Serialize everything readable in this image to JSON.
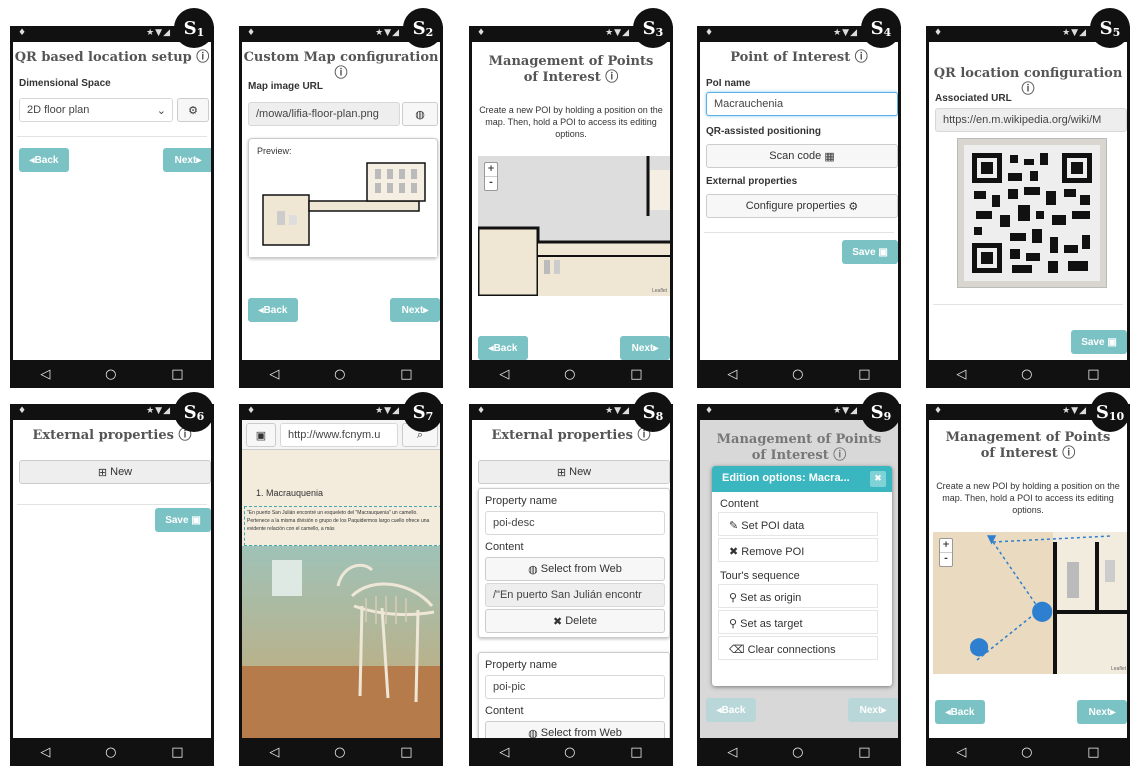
{
  "badges": [
    "S",
    "S",
    "S",
    "S",
    "S",
    "S",
    "S",
    "S",
    "S",
    "S"
  ],
  "badge_nums": [
    "1",
    "2",
    "3",
    "4",
    "5",
    "6",
    "7",
    "8",
    "9",
    "10"
  ],
  "status_icons": {
    "left": "♦",
    "right": "★▼◢"
  },
  "nav": {
    "back": "◁",
    "home": "○",
    "recent": "□"
  },
  "s1": {
    "title": "QR based location setup",
    "dimensional_label": "Dimensional Space",
    "select_value": "2D floor plan",
    "back": "Back",
    "next": "Next"
  },
  "s2": {
    "title": "Custom Map configuration",
    "url_label": "Map image URL",
    "url_value": "/mowa/lifia-floor-plan.png",
    "preview_label": "Preview:",
    "back": "Back",
    "next": "Next"
  },
  "s3": {
    "title": "Management of Points of Interest",
    "hint": "Create a new POI by holding a position on the map. Then, hold a POI to access its editing options.",
    "leaflet": "Leaflet",
    "back": "Back",
    "next": "Next"
  },
  "s4": {
    "title": "Point of Interest",
    "poi_label": "PoI name",
    "poi_value": "Macrauchenia",
    "qr_label": "QR-assisted positioning",
    "scan": "Scan code",
    "ext_label": "External properties",
    "configure": "Configure properties",
    "save": "Save"
  },
  "s5": {
    "title": "QR location configuration",
    "url_label": "Associated URL",
    "url_value": "https://en.m.wikipedia.org/wiki/M",
    "save": "Save"
  },
  "s6": {
    "title": "External properties",
    "new": "New",
    "save": "Save"
  },
  "s7": {
    "url": "http://www.fcnym.u",
    "heading": "1. Macrauquenia",
    "quote": "\"En puerto San Julián encontré un esqueleto del \"Macrauquenia\" un camello. Pertenece a la misma división o grupo de los Paquidermos largo cuello ofrece una evidente relación con el camello, a más"
  },
  "s8": {
    "title": "External properties",
    "new": "New",
    "prop_name_label": "Property name",
    "prop1_name": "poi-desc",
    "content_label": "Content",
    "select_web": "Select from Web",
    "content1_value": "/\"En puerto San Julián encontr",
    "delete": "Delete",
    "prop2_name": "poi-pic",
    "content_label2": "Content",
    "select_web2": "Select from Web"
  },
  "s9": {
    "title": "Management of Points of Interest",
    "popup_header": "Edition options: Macra...",
    "content_section": "Content",
    "set_poi": "Set POI data",
    "remove_poi": "Remove POI",
    "tour_section": "Tour's sequence",
    "set_origin": "Set as origin",
    "set_target": "Set as target",
    "clear": "Clear connections",
    "back": "Back",
    "next": "Next"
  },
  "s10": {
    "title": "Management of Points of Interest",
    "hint": "Create a new POI by holding a position on the map. Then, hold a POI to access its editing options.",
    "leaflet": "Leaflet",
    "back": "Back",
    "next": "Next"
  },
  "colors": {
    "teal": "#7bc2c4",
    "popup": "#39b6bf",
    "marker": "#2f7fd0"
  }
}
